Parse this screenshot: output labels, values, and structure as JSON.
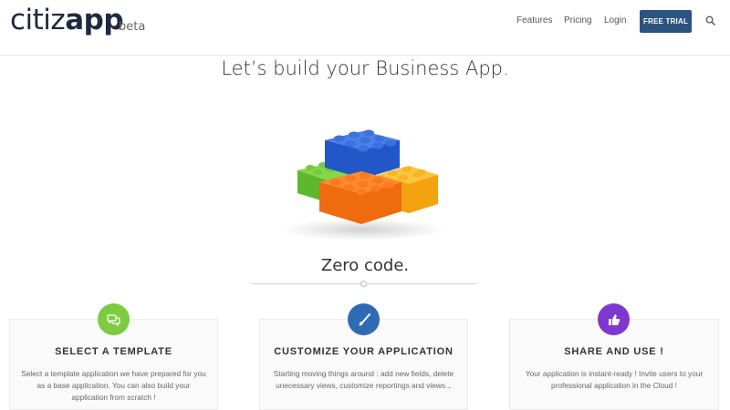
{
  "header": {
    "logo_light": "citiz",
    "logo_bold": "app",
    "logo_badge": "beta",
    "nav": {
      "features": "Features",
      "pricing": "Pricing",
      "login": "Login",
      "trial": "FREE TRIAL"
    },
    "icons": {
      "search": "search-icon"
    }
  },
  "hero": {
    "title": "Let’s build your Business App.",
    "image": "lego-bricks-illustration",
    "subtitle": "Zero code."
  },
  "cards": [
    {
      "icon": "chat-bubbles-icon",
      "color": "#7dcb3f",
      "title": "SELECT A TEMPLATE",
      "text": "Select a template application we have prepared for you as a base application. You can also build your application from scratch !"
    },
    {
      "icon": "brush-icon",
      "color": "#2e6bb5",
      "title": "CUSTOMIZE YOUR APPLICATION",
      "text": "Starting moving things around : add new fields, delete unecessary views, customize reportings and views..."
    },
    {
      "icon": "thumbs-up-icon",
      "color": "#7c38cf",
      "title": "SHARE AND USE !",
      "text": "Your application is instant-ready ! Invite users to your professional application in the Cloud !"
    }
  ],
  "colors": {
    "brand": "#1d2a3f",
    "trial_button": "#2d5480"
  }
}
